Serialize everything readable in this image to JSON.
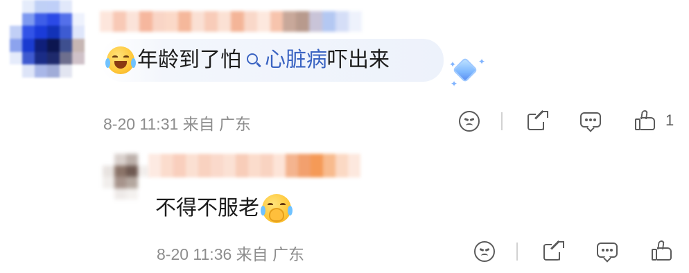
{
  "main_comment": {
    "text_before": "年龄到了怕",
    "search_link": "心脏病",
    "text_after": "吓出来",
    "emoji_leading": "laugh-cry-emoji",
    "badge_icon": "diamond-icon",
    "time": "8-20 11:31",
    "location": "来自 广东",
    "like_count": "1"
  },
  "reply_comment": {
    "text": "不得不服老",
    "emoji_trailing": "pleading-cover-mouth-emoji",
    "time": "8-20 11:36",
    "location": "来自 广东",
    "like_count": ""
  },
  "colors": {
    "link": "#3a63c2",
    "meta": "#8d8d8d",
    "icon": "#5a5a5a",
    "highlight_bg": "#edf2fb"
  },
  "mosaics": {
    "avatar_main": [
      "#ffffff",
      "#e5ecfb",
      "#bfd0f6",
      "#bfcff8",
      "#e1e8fa",
      "#ffffff",
      "#ffffff",
      "#7e9af0",
      "#3e5ee8",
      "#2b4ae6",
      "#5470ea",
      "#eef2fd",
      "#c1cff6",
      "#3253e7",
      "#1a3bd9",
      "#1232b8",
      "#3d5bd2",
      "#dfe6fb",
      "#8ca3ee",
      "#1a3bd0",
      "#0f1f7a",
      "#0c1650",
      "#3e4f8f",
      "#c6b6b3",
      "#e5ebfb",
      "#3f5ad0",
      "#1a2c86",
      "#1e2a6c",
      "#6e6f8e",
      "#cfc1c8",
      "#ffffff",
      "#dde4f8",
      "#a9b7e8",
      "#a0acd8",
      "#e2e5f1",
      "#ffffff"
    ],
    "username_main": [
      "#fde6dc",
      "#f8c9b6",
      "#fbe3d9",
      "#f6b79e",
      "#f9d5c6",
      "#fbd9c8",
      "#f5b89b",
      "#fae0d4",
      "#f8ccb9",
      "#fbe1d4",
      "#f4b598",
      "#f9d8c9",
      "#fde8de",
      "#f7c4ad",
      "#c8a89a",
      "#b89a8d",
      "#c9c4d8",
      "#b4c8f2",
      "#d5def7",
      "#eef2fc"
    ],
    "avatar_reply": [
      "#ffffff",
      "#d9d0cc",
      "#bcb0aa",
      "#ffffff",
      "#e8e3e0",
      "#8b7469",
      "#6f5a52",
      "#f2eeec",
      "#f1eeec",
      "#a7948c",
      "#b4a79f",
      "#ffffff",
      "#ffffff",
      "#eeeae8",
      "#f4f1ef",
      "#ffffff"
    ],
    "username_reply": [
      "#fdeae2",
      "#fbdccd",
      "#f9cfbd",
      "#fbe0d2",
      "#f9d2c0",
      "#fad9cb",
      "#fbe1d4",
      "#f8cdb9",
      "#fbdccc",
      "#f9d3c1",
      "#fde4d8",
      "#f4b48f",
      "#f2a06e",
      "#f59a57",
      "#f8bb8e",
      "#fbd9c4",
      "#fde8de"
    ]
  }
}
